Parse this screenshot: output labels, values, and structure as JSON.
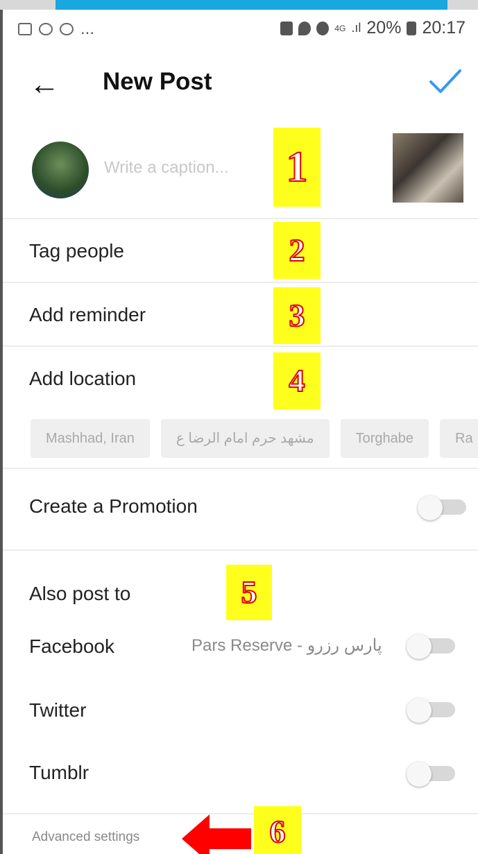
{
  "statusbar": {
    "left_icons": [
      "gallery-icon",
      "instagram-icon",
      "whatsapp-icon"
    ],
    "left_more": "...",
    "right_icons": [
      "lock-icon",
      "location-icon",
      "alarm-icon",
      "signal-icon"
    ],
    "network": "4G",
    "battery": "20%",
    "time": "20:17"
  },
  "header": {
    "title": "New Post",
    "back_icon": "back-arrow-icon",
    "confirm_icon": "checkmark-icon",
    "accent": "#3897f0"
  },
  "post": {
    "caption_placeholder": "Write a caption..."
  },
  "options": {
    "tag_people": "Tag people",
    "add_reminder": "Add reminder",
    "add_location": "Add location"
  },
  "location_chips": [
    "Mashhad, Iran",
    "مشهد حرم امام الرضا ع",
    "Torghabe",
    "Ra"
  ],
  "promotion": {
    "label": "Create a Promotion",
    "enabled": false
  },
  "also_post": {
    "heading": "Also post to",
    "facebook": {
      "label": "Facebook",
      "account": "Pars Reserve - پارس رزرو",
      "enabled": false
    },
    "twitter": {
      "label": "Twitter",
      "enabled": false
    },
    "tumblr": {
      "label": "Tumblr",
      "enabled": false
    }
  },
  "advanced_settings": "Advanced settings",
  "markers": [
    "1",
    "2",
    "3",
    "4",
    "5",
    "6"
  ],
  "marker_colors": {
    "background": "#ffff1e",
    "digit_outline": "#dd0000",
    "arrow": "#ff0000"
  }
}
